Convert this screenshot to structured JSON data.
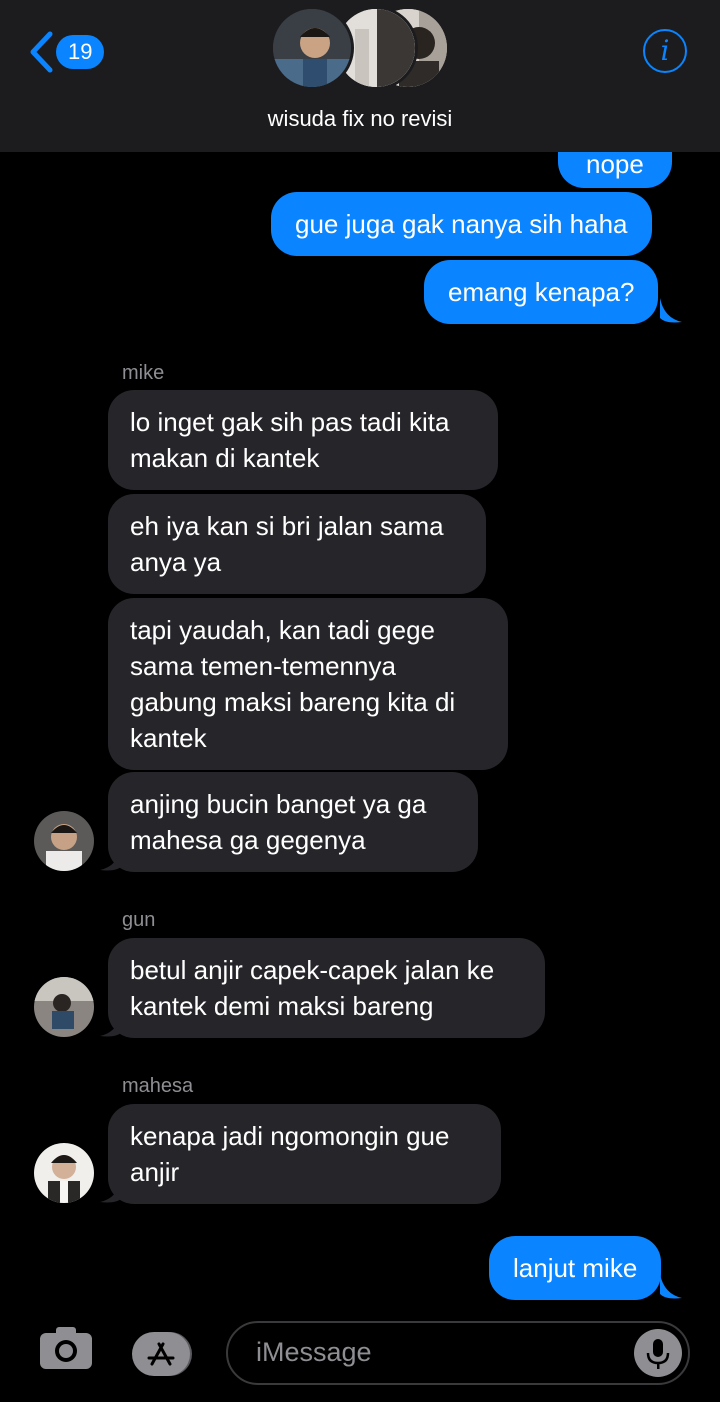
{
  "header": {
    "back_count": "19",
    "group_name": "wisuda fix no revisi",
    "info_glyph": "i"
  },
  "messages": [
    {
      "dir": "out",
      "text": "nope"
    },
    {
      "dir": "out",
      "text": "gue juga gak nanya sih haha"
    },
    {
      "dir": "out",
      "text": "emang kenapa?"
    },
    {
      "sender": "mike",
      "dir": "in",
      "text": "lo inget gak sih pas tadi kita makan di kantek"
    },
    {
      "dir": "in",
      "text": "eh iya kan si bri jalan sama anya ya"
    },
    {
      "dir": "in",
      "text": "tapi yaudah, kan tadi gege sama temen-temennya gabung maksi bareng kita di kantek"
    },
    {
      "dir": "in",
      "text": "anjing bucin banget ya ga mahesa ga gegenya"
    },
    {
      "sender": "gun",
      "dir": "in",
      "text": "betul anjir capek-capek jalan ke kantek demi maksi bareng"
    },
    {
      "sender": "mahesa",
      "dir": "in",
      "text": "kenapa jadi ngomongin gue anjir"
    },
    {
      "dir": "out",
      "text": "lanjut mike"
    }
  ],
  "composer": {
    "placeholder": "iMessage"
  },
  "colors": {
    "accent": "#0a84ff",
    "incoming_bubble": "#26252a",
    "header_bg": "#1c1c1e"
  }
}
